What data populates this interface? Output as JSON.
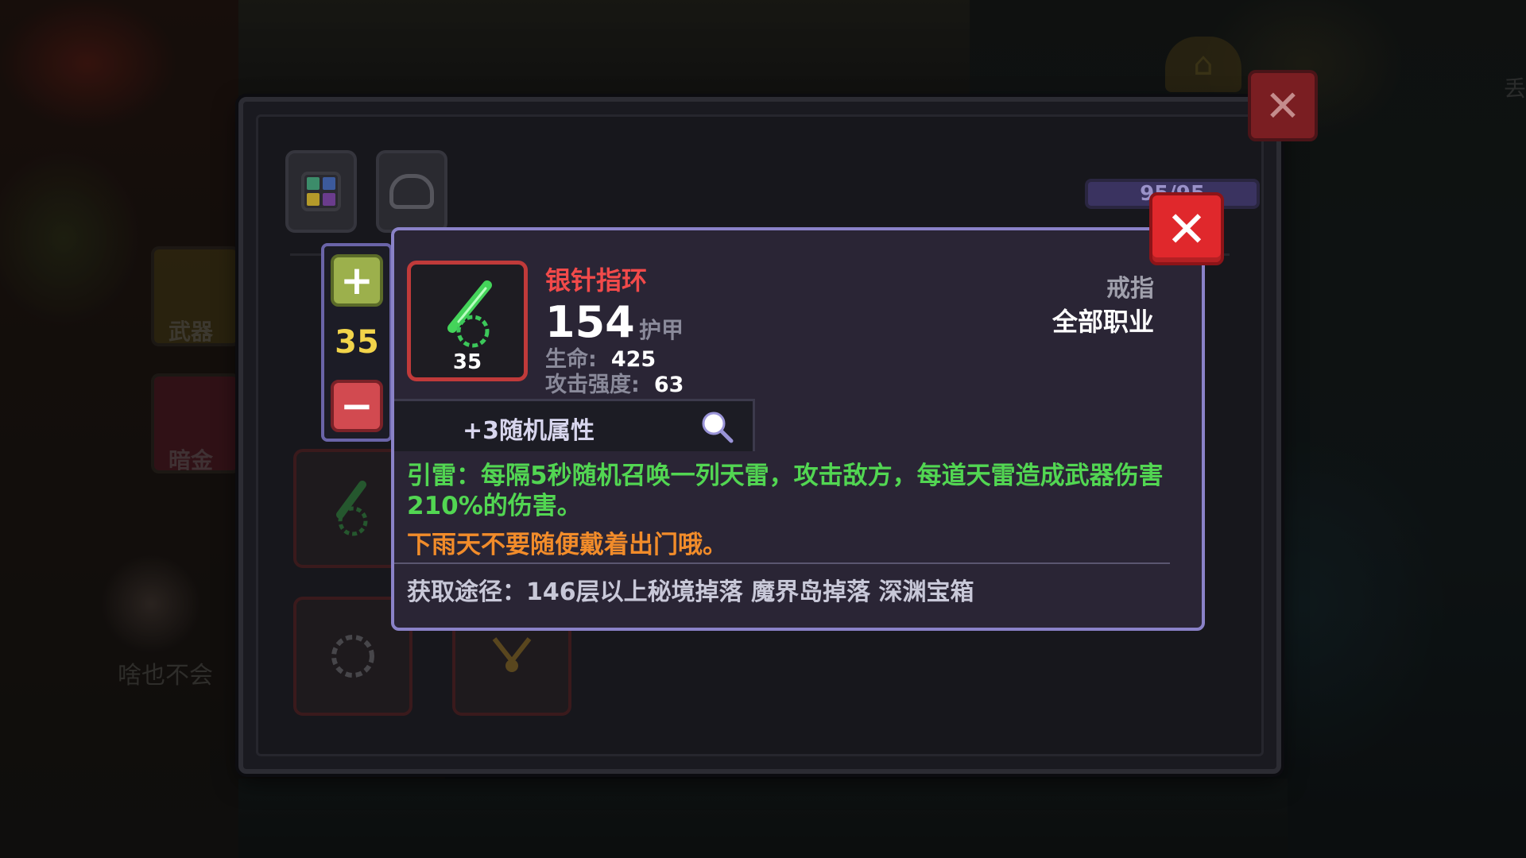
{
  "background": {
    "side_tabs": [
      {
        "label": "武器"
      },
      {
        "label": "暗金"
      }
    ],
    "faded_text": "啥也不会",
    "drop_label": "丢"
  },
  "inventory": {
    "capacity": "95/95",
    "tabs": [
      {
        "icon": "grid-icon"
      },
      {
        "icon": "pot-icon"
      }
    ],
    "close_label": "✕"
  },
  "level_stepper": {
    "plus_label": "+",
    "value": "35",
    "minus_label": "−"
  },
  "item": {
    "name": "银针指环",
    "level": "35",
    "score": "154",
    "score_type": "护甲",
    "stats": [
      {
        "label": "生命:",
        "value": "425"
      },
      {
        "label": "攻击强度:",
        "value": "63"
      }
    ],
    "slot_type": "戒指",
    "class_restriction": "全部职业",
    "random_attributes": "+3随机属性",
    "effect": "引雷：每隔5秒随机召唤一列天雷，攻击敌方，每道天雷造成武器伤害210%的伤害。",
    "flavor": "下雨天不要随便戴着出门哦。",
    "source": "获取途径：146层以上秘境掉落 魔界岛掉落 深渊宝箱",
    "name_color": "#f24a4a",
    "effect_color": "#52d652",
    "flavor_color": "#f28c2a"
  },
  "detail_close_label": "✕"
}
